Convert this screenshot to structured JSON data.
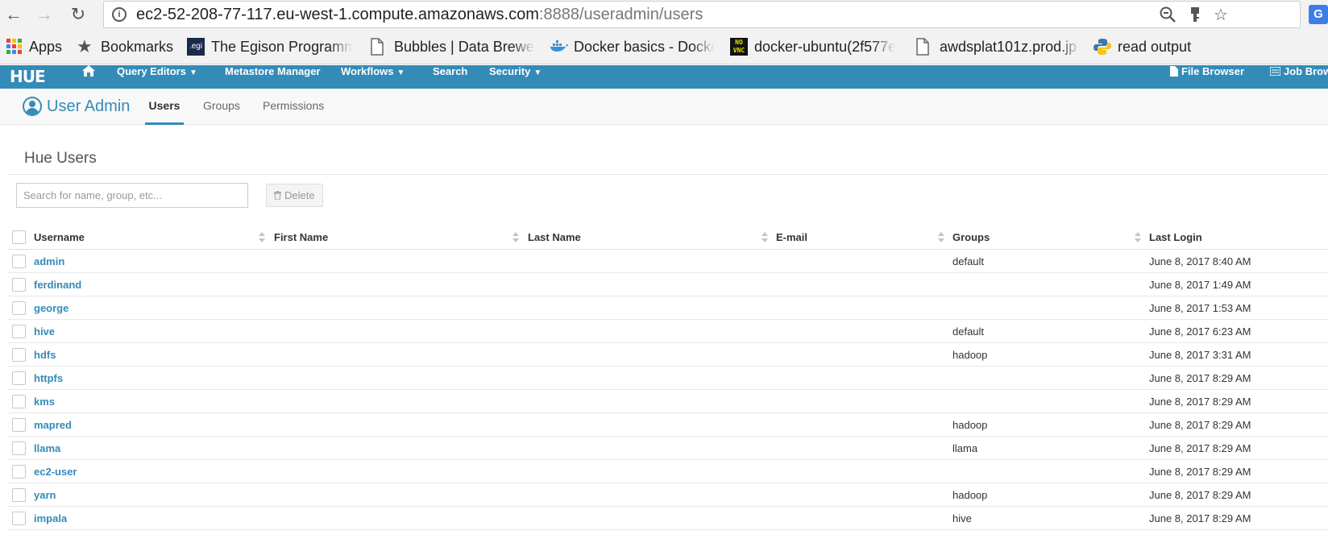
{
  "browser": {
    "url_host": "ec2-52-208-77-117.eu-west-1.compute.amazonaws.com",
    "url_path": ":8888/useradmin/users",
    "bookmarks": [
      {
        "label": "Apps"
      },
      {
        "label": "Bookmarks"
      },
      {
        "label": "The Egison Programm"
      },
      {
        "label": "Bubbles | Data Brewer"
      },
      {
        "label": "Docker basics - Docke"
      },
      {
        "label": "docker-ubuntu(2f577e"
      },
      {
        "label": "awdsplat101z.prod.jp"
      },
      {
        "label": "read output"
      }
    ],
    "ext_letter": "G"
  },
  "hue_nav": {
    "logo": "HUE",
    "items": [
      {
        "label": "Query Editors"
      },
      {
        "label": "Metastore Manager"
      },
      {
        "label": "Workflows"
      },
      {
        "label": "Search"
      },
      {
        "label": "Security"
      }
    ],
    "right_items": [
      {
        "label": "File Browser"
      },
      {
        "label": "Job Brow"
      }
    ]
  },
  "app": {
    "title": "User Admin",
    "tabs": [
      {
        "label": "Users"
      },
      {
        "label": "Groups"
      },
      {
        "label": "Permissions"
      }
    ]
  },
  "page": {
    "title": "Hue Users",
    "search_placeholder": "Search for name, group, etc...",
    "delete_label": "Delete"
  },
  "table": {
    "columns": [
      "Username",
      "First Name",
      "Last Name",
      "E-mail",
      "Groups",
      "Last Login"
    ],
    "rows": [
      {
        "username": "admin",
        "first": "",
        "last": "",
        "email": "",
        "groups": "default",
        "last_login": "June 8, 2017 8:40 AM"
      },
      {
        "username": "ferdinand",
        "first": "",
        "last": "",
        "email": "",
        "groups": "",
        "last_login": "June 8, 2017 1:49 AM"
      },
      {
        "username": "george",
        "first": "",
        "last": "",
        "email": "",
        "groups": "",
        "last_login": "June 8, 2017 1:53 AM"
      },
      {
        "username": "hive",
        "first": "",
        "last": "",
        "email": "",
        "groups": "default",
        "last_login": "June 8, 2017 6:23 AM"
      },
      {
        "username": "hdfs",
        "first": "",
        "last": "",
        "email": "",
        "groups": "hadoop",
        "last_login": "June 8, 2017 3:31 AM"
      },
      {
        "username": "httpfs",
        "first": "",
        "last": "",
        "email": "",
        "groups": "",
        "last_login": "June 8, 2017 8:29 AM"
      },
      {
        "username": "kms",
        "first": "",
        "last": "",
        "email": "",
        "groups": "",
        "last_login": "June 8, 2017 8:29 AM"
      },
      {
        "username": "mapred",
        "first": "",
        "last": "",
        "email": "",
        "groups": "hadoop",
        "last_login": "June 8, 2017 8:29 AM"
      },
      {
        "username": "llama",
        "first": "",
        "last": "",
        "email": "",
        "groups": "llama",
        "last_login": "June 8, 2017 8:29 AM"
      },
      {
        "username": "ec2-user",
        "first": "",
        "last": "",
        "email": "",
        "groups": "",
        "last_login": "June 8, 2017 8:29 AM"
      },
      {
        "username": "yarn",
        "first": "",
        "last": "",
        "email": "",
        "groups": "hadoop",
        "last_login": "June 8, 2017 8:29 AM"
      },
      {
        "username": "impala",
        "first": "",
        "last": "",
        "email": "",
        "groups": "hive",
        "last_login": "June 8, 2017 8:29 AM"
      }
    ]
  },
  "colors": {
    "hue_blue": "#338bb8",
    "link": "#338bb8"
  }
}
